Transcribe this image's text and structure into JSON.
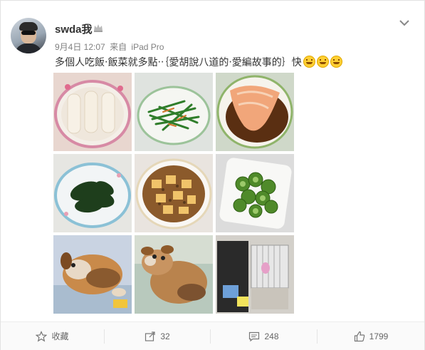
{
  "post": {
    "username": "swda我",
    "date": "9月4日 12:07",
    "source_prefix": "来自",
    "source": "iPad Pro",
    "text": "多個人吃飯‧飯菜就多點‧‧｛愛胡說八道的‧愛編故事的｝快",
    "emoji_count": 3
  },
  "photos": [
    {
      "subject": "rice-noodle-rolls"
    },
    {
      "subject": "stir-fried-chives"
    },
    {
      "subject": "steamed-salmon"
    },
    {
      "subject": "sweet-potato-leaves"
    },
    {
      "subject": "mapo-tofu"
    },
    {
      "subject": "brussels-sprouts"
    },
    {
      "subject": "puppy-sleeping"
    },
    {
      "subject": "puppy-lying"
    },
    {
      "subject": "birdcage"
    }
  ],
  "actions": {
    "favorite_label": "收藏",
    "repost_count": "32",
    "comment_count": "248",
    "like_count": "1799"
  },
  "colors": {
    "text": "#333333",
    "meta": "#808080",
    "action": "#666666"
  },
  "icons": {
    "favorite": "star-icon",
    "repost": "share-icon",
    "comment": "comment-icon",
    "like": "thumbs-up-icon",
    "menu": "chevron-down-icon",
    "badge": "crown-icon"
  }
}
